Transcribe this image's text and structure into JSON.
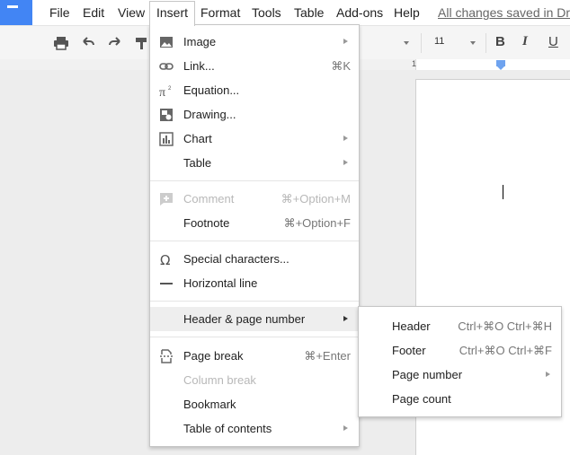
{
  "menubar": {
    "items": [
      "File",
      "Edit",
      "View",
      "Insert",
      "Format",
      "Tools",
      "Table",
      "Add-ons",
      "Help"
    ],
    "save_status": "All changes saved in Drive"
  },
  "toolbar": {
    "font_size": "11",
    "icons": [
      "print-icon",
      "undo-icon",
      "redo-icon",
      "paint-format-icon",
      "bold-icon",
      "italic-icon",
      "underline-icon"
    ],
    "bold": "B",
    "italic": "I",
    "underline": "U"
  },
  "ruler": {
    "label": "1"
  },
  "insert_menu": {
    "items": [
      {
        "label": "Image",
        "icon": "image-icon",
        "submenu": true
      },
      {
        "label": "Link...",
        "icon": "link-icon",
        "shortcut": "⌘K"
      },
      {
        "label": "Equation...",
        "icon": "equation-icon"
      },
      {
        "label": "Drawing...",
        "icon": "drawing-icon"
      },
      {
        "label": "Chart",
        "icon": "chart-icon",
        "submenu": true
      },
      {
        "label": "Table",
        "submenu": true
      },
      {
        "label": "Comment",
        "icon": "comment-icon",
        "shortcut": "⌘+Option+M",
        "disabled": true
      },
      {
        "label": "Footnote",
        "shortcut": "⌘+Option+F"
      },
      {
        "label": "Special characters...",
        "icon": "omega-icon"
      },
      {
        "label": "Horizontal line",
        "icon": "horizontal-line-icon"
      },
      {
        "label": "Header & page number",
        "submenu": true,
        "highlighted": true
      },
      {
        "label": "Page break",
        "icon": "page-break-icon",
        "shortcut": "⌘+Enter"
      },
      {
        "label": "Column break",
        "disabled": true
      },
      {
        "label": "Bookmark"
      },
      {
        "label": "Table of contents",
        "submenu": true
      }
    ]
  },
  "header_submenu": {
    "items": [
      {
        "label": "Header",
        "shortcut": "Ctrl+⌘O Ctrl+⌘H"
      },
      {
        "label": "Footer",
        "shortcut": "Ctrl+⌘O Ctrl+⌘F"
      },
      {
        "label": "Page number",
        "submenu": true
      },
      {
        "label": "Page count"
      }
    ]
  },
  "colors": {
    "logo": "#4285f4",
    "highlight": "#eeeeee",
    "ruler_marker": "#6fa3ef"
  }
}
